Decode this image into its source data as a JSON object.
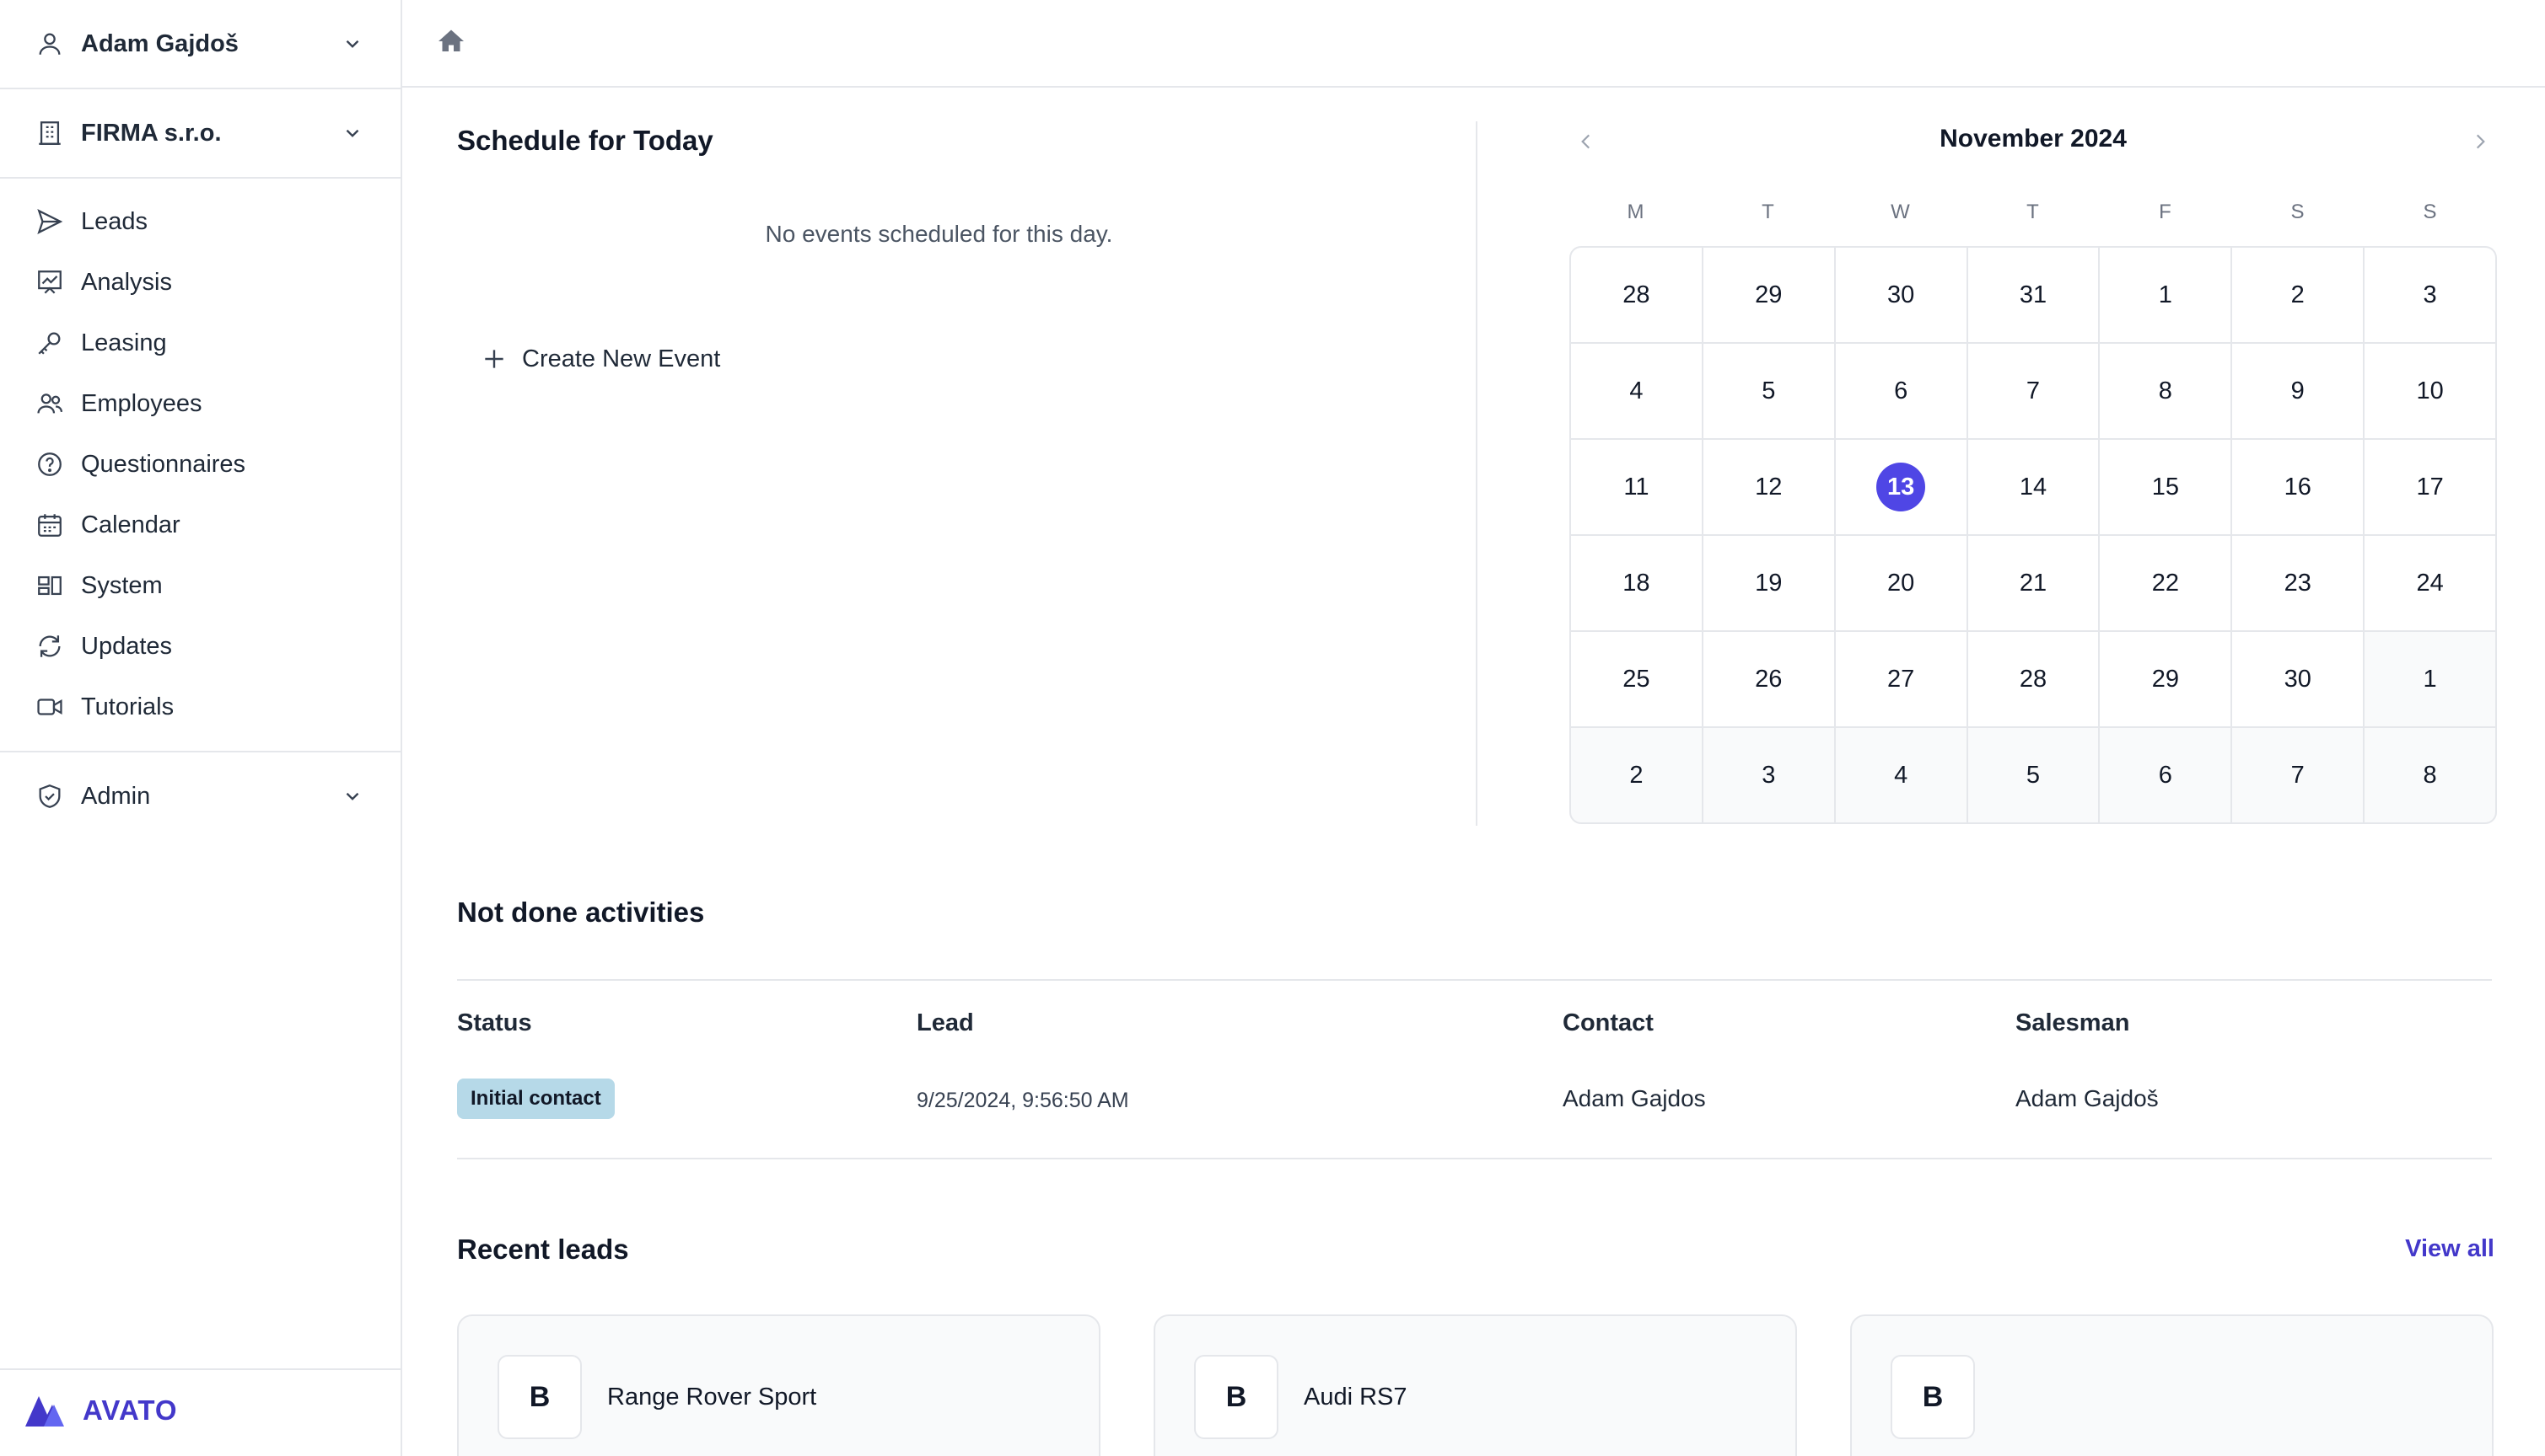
{
  "sidebar": {
    "user_name": "Adam Gajdoš",
    "company_name": "FIRMA s.r.o.",
    "nav": [
      {
        "label": "Leads",
        "icon": "paper-plane-icon"
      },
      {
        "label": "Analysis",
        "icon": "chart-board-icon"
      },
      {
        "label": "Leasing",
        "icon": "key-icon"
      },
      {
        "label": "Employees",
        "icon": "users-icon"
      },
      {
        "label": "Questionnaires",
        "icon": "question-circle-icon"
      },
      {
        "label": "Calendar",
        "icon": "calendar-icon"
      },
      {
        "label": "System",
        "icon": "system-blocks-icon"
      },
      {
        "label": "Updates",
        "icon": "refresh-icon"
      },
      {
        "label": "Tutorials",
        "icon": "video-camera-icon"
      }
    ],
    "admin_label": "Admin",
    "logo_text": "AVATO"
  },
  "topbar": {
    "icon": "home-icon"
  },
  "schedule": {
    "title": "Schedule for Today",
    "empty_text": "No events scheduled for this day.",
    "create_label": "Create New Event"
  },
  "calendar": {
    "month_label": "November 2024",
    "weekdays": [
      "M",
      "T",
      "W",
      "T",
      "F",
      "S",
      "S"
    ],
    "weeks": [
      [
        {
          "d": "28",
          "out": false
        },
        {
          "d": "29",
          "out": false
        },
        {
          "d": "30",
          "out": false
        },
        {
          "d": "31",
          "out": false
        },
        {
          "d": "1",
          "out": false
        },
        {
          "d": "2",
          "out": false
        },
        {
          "d": "3",
          "out": false
        }
      ],
      [
        {
          "d": "4",
          "out": false
        },
        {
          "d": "5",
          "out": false
        },
        {
          "d": "6",
          "out": false
        },
        {
          "d": "7",
          "out": false
        },
        {
          "d": "8",
          "out": false
        },
        {
          "d": "9",
          "out": false
        },
        {
          "d": "10",
          "out": false
        }
      ],
      [
        {
          "d": "11",
          "out": false
        },
        {
          "d": "12",
          "out": false
        },
        {
          "d": "13",
          "out": false,
          "selected": true
        },
        {
          "d": "14",
          "out": false
        },
        {
          "d": "15",
          "out": false
        },
        {
          "d": "16",
          "out": false
        },
        {
          "d": "17",
          "out": false
        }
      ],
      [
        {
          "d": "18",
          "out": false
        },
        {
          "d": "19",
          "out": false
        },
        {
          "d": "20",
          "out": false
        },
        {
          "d": "21",
          "out": false
        },
        {
          "d": "22",
          "out": false
        },
        {
          "d": "23",
          "out": false
        },
        {
          "d": "24",
          "out": false
        }
      ],
      [
        {
          "d": "25",
          "out": false
        },
        {
          "d": "26",
          "out": false
        },
        {
          "d": "27",
          "out": false
        },
        {
          "d": "28",
          "out": false
        },
        {
          "d": "29",
          "out": false
        },
        {
          "d": "30",
          "out": false
        },
        {
          "d": "1",
          "out": true
        }
      ],
      [
        {
          "d": "2",
          "out": true
        },
        {
          "d": "3",
          "out": true
        },
        {
          "d": "4",
          "out": true
        },
        {
          "d": "5",
          "out": true
        },
        {
          "d": "6",
          "out": true
        },
        {
          "d": "7",
          "out": true
        },
        {
          "d": "8",
          "out": true
        }
      ]
    ],
    "accent_color": "#4f46e5"
  },
  "activities": {
    "title": "Not done activities",
    "headers": {
      "status": "Status",
      "lead": "Lead",
      "contact": "Contact",
      "salesman": "Salesman"
    },
    "rows": [
      {
        "status": "Initial contact",
        "lead": "9/25/2024, 9:56:50 AM",
        "contact": "Adam Gajdos",
        "salesman": "Adam Gajdoš"
      }
    ]
  },
  "recent_leads": {
    "title": "Recent leads",
    "view_all_label": "View all",
    "cards": [
      {
        "avatar": "B",
        "name": "Range Rover Sport"
      },
      {
        "avatar": "B",
        "name": "Audi RS7"
      },
      {
        "avatar": "B",
        "name": ""
      }
    ]
  }
}
